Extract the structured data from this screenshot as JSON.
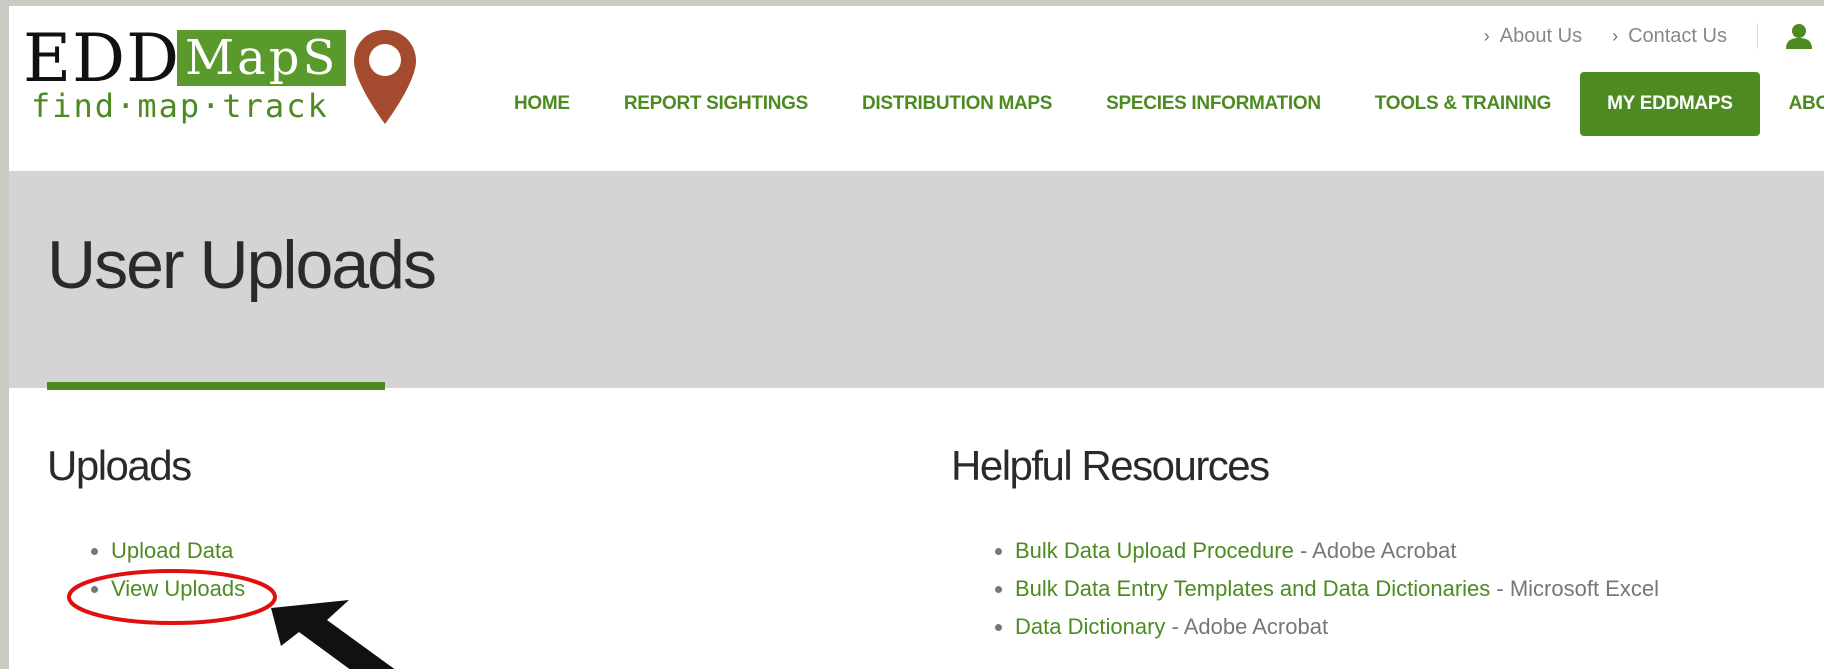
{
  "logo": {
    "edd": "EDD",
    "maps": "MapS",
    "tagline": "find·map·track"
  },
  "util_nav": [
    {
      "label": "About Us",
      "icon": "chevron-right-icon"
    },
    {
      "label": "Contact Us",
      "icon": "chevron-right-icon"
    }
  ],
  "user_icon": "user-icon",
  "main_nav": [
    {
      "label": "HOME"
    },
    {
      "label": "REPORT SIGHTINGS"
    },
    {
      "label": "DISTRIBUTION MAPS"
    },
    {
      "label": "SPECIES INFORMATION"
    },
    {
      "label": "TOOLS & TRAINING"
    },
    {
      "label": "MY EDDMAPS",
      "active": true
    },
    {
      "label": "ABOUT"
    }
  ],
  "page_title": "User Uploads",
  "uploads": {
    "heading": "Uploads",
    "links": [
      {
        "label": "Upload Data"
      },
      {
        "label": "View Uploads",
        "highlighted": true
      }
    ]
  },
  "resources": {
    "heading": "Helpful Resources",
    "items": [
      {
        "link": "Bulk Data Upload Procedure",
        "suffix": " - Adobe Acrobat"
      },
      {
        "link": "Bulk Data Entry Templates and Data Dictionaries",
        "suffix": " - Microsoft Excel"
      },
      {
        "link": "Data Dictionary",
        "suffix": " - Adobe Acrobat"
      }
    ]
  },
  "colors": {
    "brand_green": "#4d8b22",
    "pin_red": "#a44a2f",
    "annotation_red": "#e01010",
    "title_band": "#d4d4d4"
  }
}
